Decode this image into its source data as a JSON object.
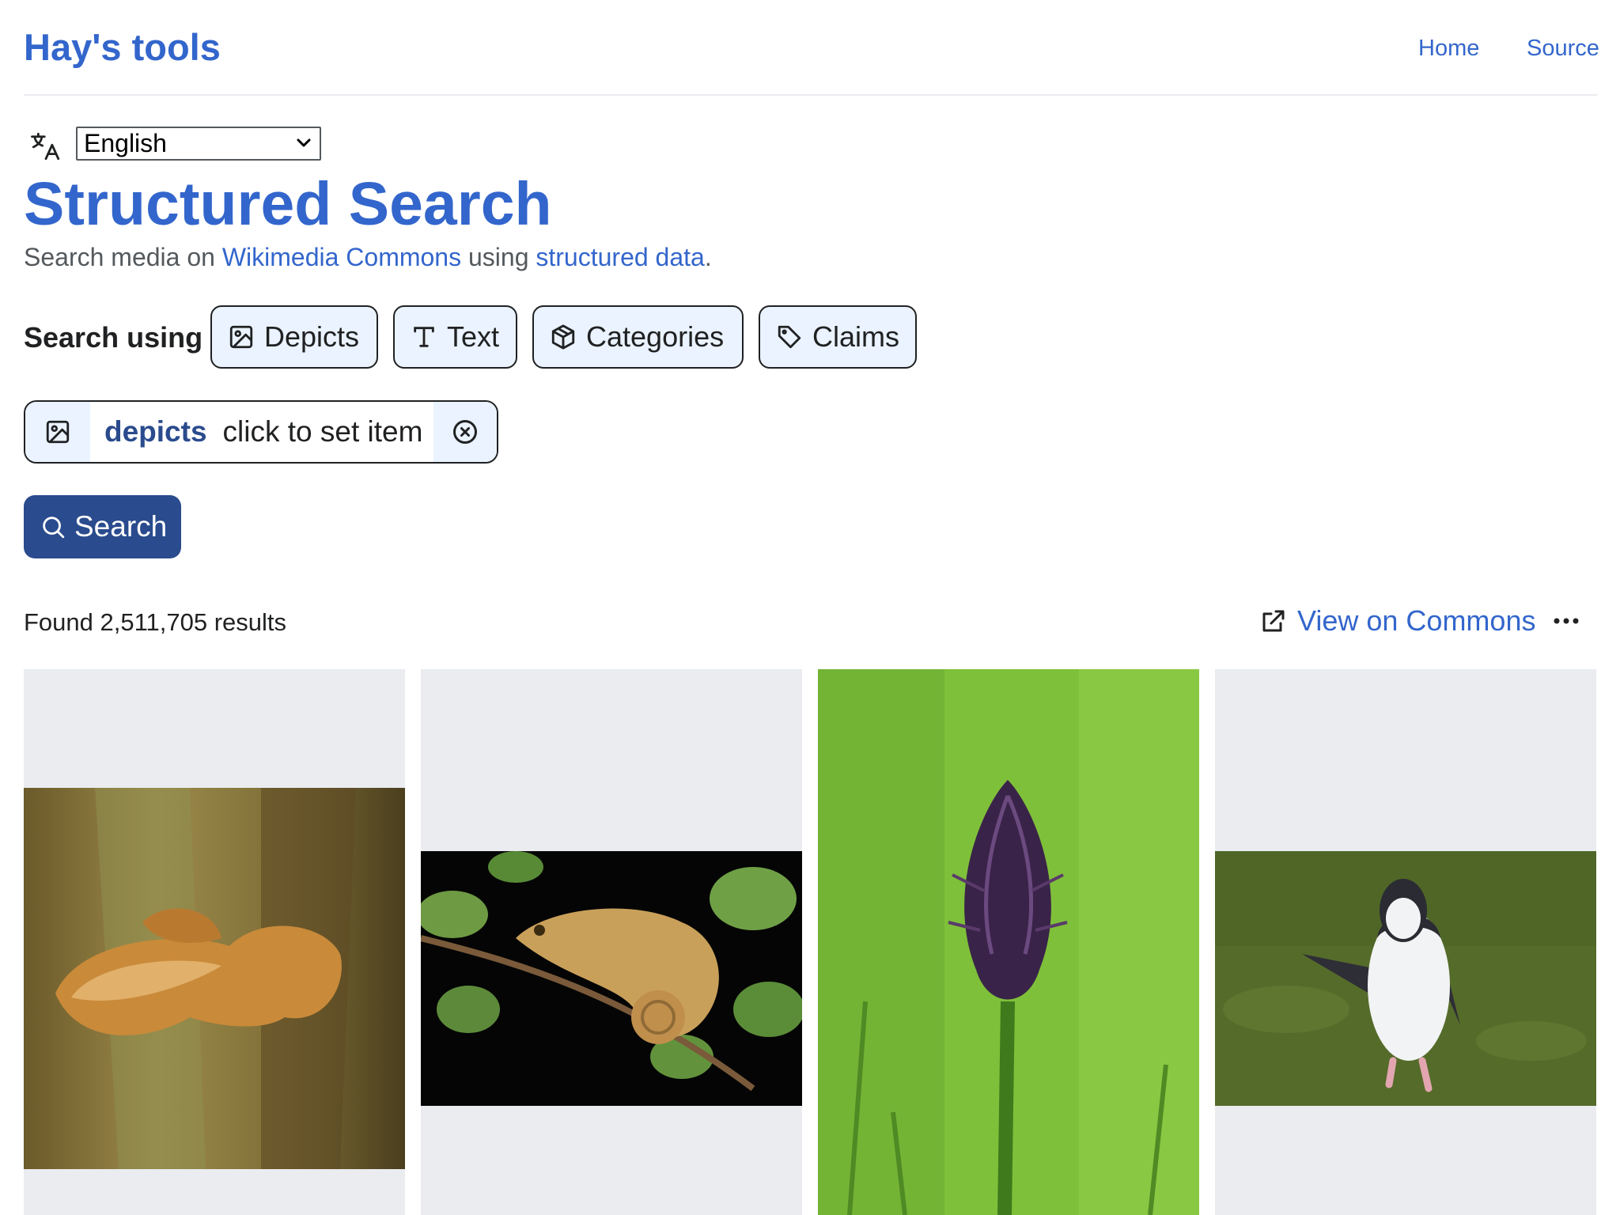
{
  "header": {
    "site_title": "Hay's tools",
    "nav": [
      {
        "label": "Home"
      },
      {
        "label": "Source"
      }
    ]
  },
  "language": {
    "icon": "translate-icon",
    "selected": "English"
  },
  "page": {
    "title": "Structured Search",
    "subtitle_prefix": "Search media on ",
    "subtitle_link1": "Wikimedia Commons",
    "subtitle_middle": " using ",
    "subtitle_link2": "structured data",
    "subtitle_suffix": "."
  },
  "search_using": {
    "label": "Search using",
    "types": [
      {
        "label": "Depicts",
        "icon": "image-icon"
      },
      {
        "label": "Text",
        "icon": "text-icon"
      },
      {
        "label": "Categories",
        "icon": "cube-icon"
      },
      {
        "label": "Claims",
        "icon": "tag-icon"
      }
    ]
  },
  "filter": {
    "icon": "image-icon",
    "property": "depicts",
    "value": "click to set item",
    "remove_icon": "close-circle-icon"
  },
  "search_button": {
    "label": "Search",
    "icon": "search-icon"
  },
  "results": {
    "count_text": "Found 2,511,705 results",
    "view_on_commons": "View on Commons",
    "view_icon": "external-link-icon",
    "more_icon": "more-icon"
  },
  "thumbnails": [
    {
      "subject": "bracket fungus on tree"
    },
    {
      "subject": "chameleon on branch"
    },
    {
      "subject": "purple flower spike"
    },
    {
      "subject": "chinstrap penguin"
    }
  ],
  "colors": {
    "link": "#3366cc",
    "primary": "#2a4b8d",
    "button_bg": "#eaf3ff",
    "tile_bg": "#eaecf0"
  }
}
